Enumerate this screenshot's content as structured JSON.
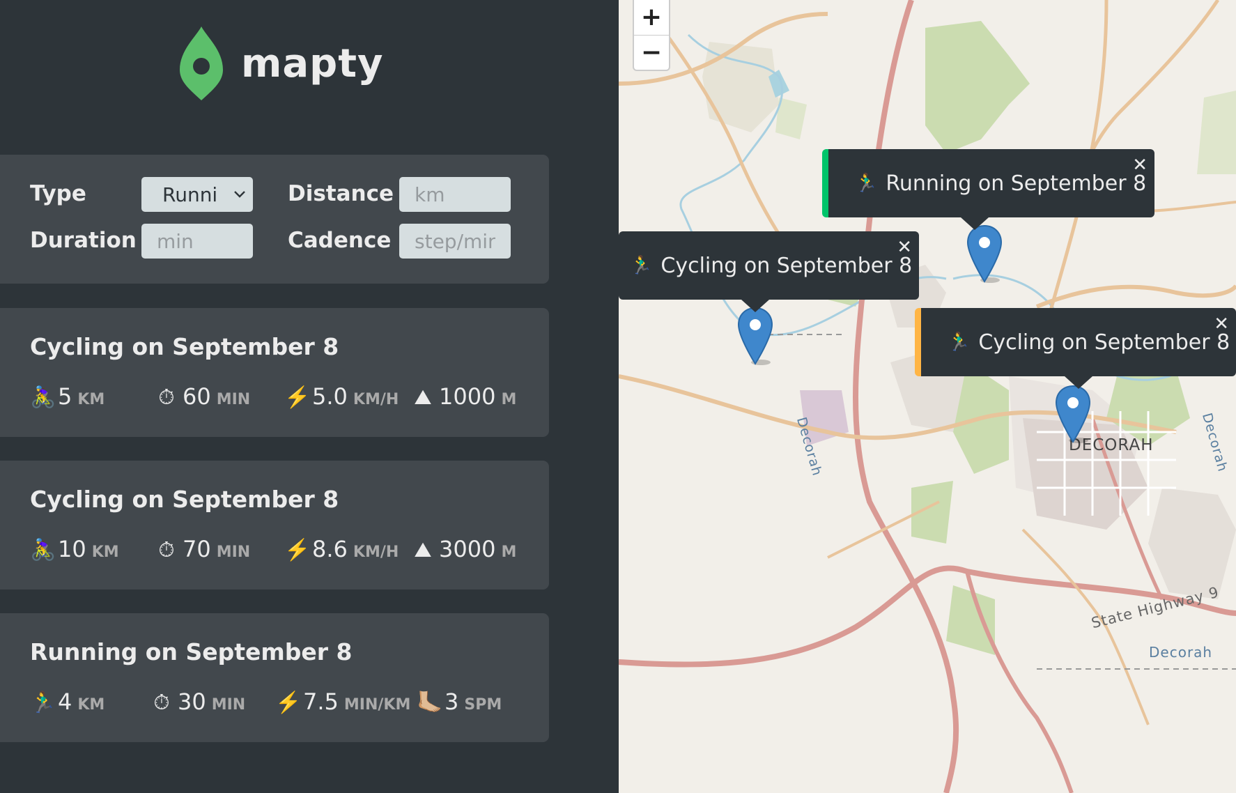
{
  "app": {
    "name": "mapty"
  },
  "form": {
    "type_label": "Type",
    "type_value": "Runni",
    "distance_label": "Distance",
    "distance_placeholder": "km",
    "duration_label": "Duration",
    "duration_placeholder": "min",
    "cadence_label": "Cadence",
    "cadence_placeholder": "step/min"
  },
  "workouts": [
    {
      "title": "Cycling on September 8",
      "stats": [
        {
          "icon": "🚴‍♀️",
          "value": "5",
          "unit": "KM"
        },
        {
          "icon": "⏱",
          "value": "60",
          "unit": "MIN"
        },
        {
          "icon": "⚡️",
          "value": "5.0",
          "unit": "KM/H"
        },
        {
          "icon": "⛰",
          "value": "1000",
          "unit": "M"
        }
      ]
    },
    {
      "title": "Cycling on September 8",
      "stats": [
        {
          "icon": "🚴‍♀️",
          "value": "10",
          "unit": "KM"
        },
        {
          "icon": "⏱",
          "value": "70",
          "unit": "MIN"
        },
        {
          "icon": "⚡️",
          "value": "8.6",
          "unit": "KM/H"
        },
        {
          "icon": "⛰",
          "value": "3000",
          "unit": "M"
        }
      ]
    },
    {
      "title": "Running on September 8",
      "stats": [
        {
          "icon": "🏃‍♂️",
          "value": "4",
          "unit": "KM"
        },
        {
          "icon": "⏱",
          "value": "30",
          "unit": "MIN"
        },
        {
          "icon": "⚡️",
          "value": "7.5",
          "unit": "MIN/KM"
        },
        {
          "icon": "🦶🏼",
          "value": "3",
          "unit": "SPM"
        }
      ]
    }
  ],
  "map": {
    "zoom_in": "+",
    "zoom_out": "−",
    "popups": [
      {
        "icon": "🏃‍♂️",
        "text": "Running on September 8",
        "close": "✕",
        "type": "running"
      },
      {
        "icon": "🏃‍♂️",
        "text": "Cycling on September 8",
        "close": "✕",
        "type": "cycling-plain"
      },
      {
        "icon": "🏃‍♂️",
        "text": "Cycling on September 8",
        "close": "✕",
        "type": "cycling"
      }
    ],
    "labels": {
      "city": "DECORAH",
      "highway": "State Highway 9",
      "river_1": "Decorah",
      "river_2": "Decorah",
      "area": "Decorah"
    }
  },
  "colors": {
    "running": "#00c46a",
    "cycling": "#ffb545",
    "marker": "#3f87cc"
  }
}
